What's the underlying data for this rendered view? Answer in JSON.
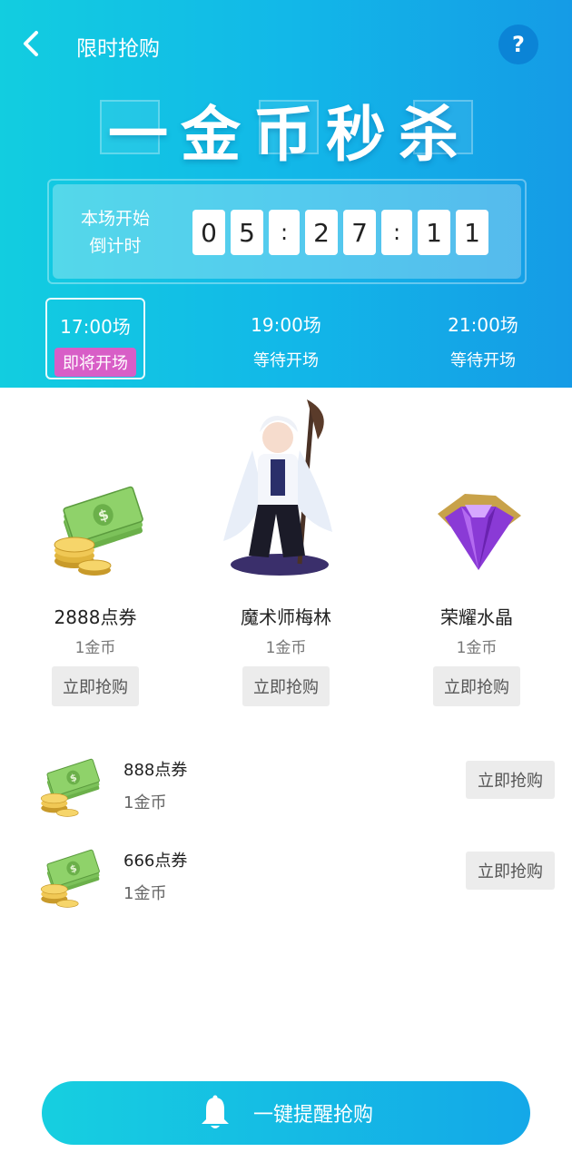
{
  "nav": {
    "title": "限时抢购",
    "help": "?"
  },
  "banner": {
    "title_chars": [
      "一",
      "金",
      "币",
      "秒",
      "杀"
    ]
  },
  "countdown": {
    "label_line1": "本场开始",
    "label_line2": "倒计时",
    "digits": [
      "0",
      "5",
      ":",
      "2",
      "7",
      ":",
      "1",
      "1"
    ]
  },
  "sessions": [
    {
      "time": "17:00场",
      "status": "即将开场",
      "active": true
    },
    {
      "time": "19:00场",
      "status": "等待开场",
      "active": false
    },
    {
      "time": "21:00场",
      "status": "等待开场",
      "active": false
    }
  ],
  "featured": [
    {
      "name": "2888点券",
      "price": "1金币",
      "button": "立即抢购",
      "icon": "cash-coins-icon"
    },
    {
      "name": "魔术师梅林",
      "price": "1金币",
      "button": "立即抢购",
      "icon": "merlin-character-image"
    },
    {
      "name": "荣耀水晶",
      "price": "1金币",
      "button": "立即抢购",
      "icon": "purple-crystal-icon"
    }
  ],
  "list": [
    {
      "name": "888点券",
      "price": "1金币",
      "button": "立即抢购",
      "icon": "cash-coins-icon"
    },
    {
      "name": "666点券",
      "price": "1金币",
      "button": "立即抢购",
      "icon": "cash-coins-icon"
    }
  ],
  "remind": {
    "label": "一键提醒抢购",
    "icon": "bell-icon"
  },
  "colors": {
    "header_start": "#12cde0",
    "header_end": "#159be6",
    "badge": "#d85ec7",
    "button_bg": "#ececec"
  }
}
